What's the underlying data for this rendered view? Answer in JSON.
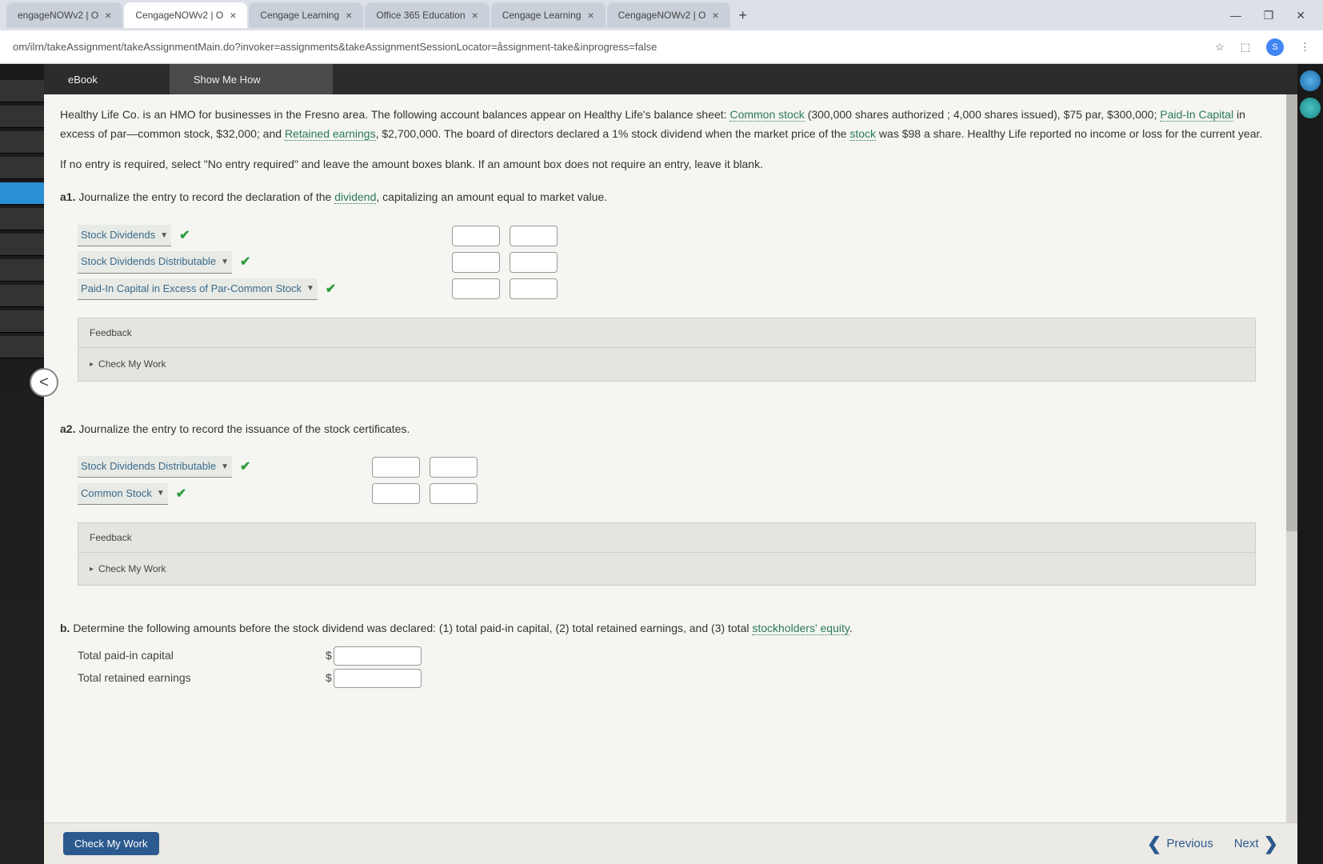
{
  "tabs": [
    {
      "label": "engageNOWv2 | O"
    },
    {
      "label": "CengageNOWv2 | O"
    },
    {
      "label": "Cengage Learning"
    },
    {
      "label": "Office 365 Education"
    },
    {
      "label": "Cengage Learning"
    },
    {
      "label": "CengageNOWv2 | O"
    }
  ],
  "url": "om/ilrn/takeAssignment/takeAssignmentMain.do?invoker=assignments&takeAssignmentSessionLocator=åssignment-take&inprogress=false",
  "avatar": "S",
  "topbar": {
    "ebook": "eBook",
    "show": "Show Me How"
  },
  "problem": {
    "p1a": "Healthy Life Co. is an HMO for businesses in the Fresno area. The following account balances appear on Healthy Life's balance sheet: ",
    "t1": "Common stock",
    "p1b": " (300,000 shares authorized ; 4,000 shares issued), $75 par, $300,000; ",
    "t2": "Paid-In Capital",
    "p1c": " in excess of par—common stock, $32,000; and ",
    "t3": "Retained earnings",
    "p1d": ", $2,700,000. The board of directors declared a 1% stock dividend when the market price of the ",
    "t4": "stock",
    "p1e": " was $98 a share. Healthy Life reported no income or loss for the current year.",
    "instr": "If no entry is required, select \"No entry required\" and leave the amount boxes blank. If an amount box does not require an entry, leave it blank."
  },
  "a1": {
    "head_a": "a1.",
    "head_b": "  Journalize the entry to record the declaration of the ",
    "term": "dividend",
    "head_c": ", capitalizing an amount equal to market value.",
    "rows": [
      {
        "account": "Stock Dividends"
      },
      {
        "account": "Stock Dividends Distributable"
      },
      {
        "account": "Paid-In Capital in Excess of Par-Common Stock"
      }
    ]
  },
  "a2": {
    "head_a": "a2.",
    "head_b": "  Journalize the entry to record the issuance of the stock certificates.",
    "rows": [
      {
        "account": "Stock Dividends Distributable"
      },
      {
        "account": "Common Stock"
      }
    ]
  },
  "feedback": {
    "title": "Feedback",
    "check": "Check My Work"
  },
  "b": {
    "head_a": "b.",
    "head_b": "  Determine the following amounts before the stock dividend was declared: (1) total paid-in capital, (2) total retained earnings, and (3) total ",
    "term": "stockholders' equity",
    "head_c": ".",
    "rows": [
      {
        "label": "Total paid-in capital"
      },
      {
        "label": "Total retained earnings"
      }
    ],
    "dollar": "$"
  },
  "bottom": {
    "check": "Check My Work",
    "prev": "Previous",
    "next": "Next"
  }
}
